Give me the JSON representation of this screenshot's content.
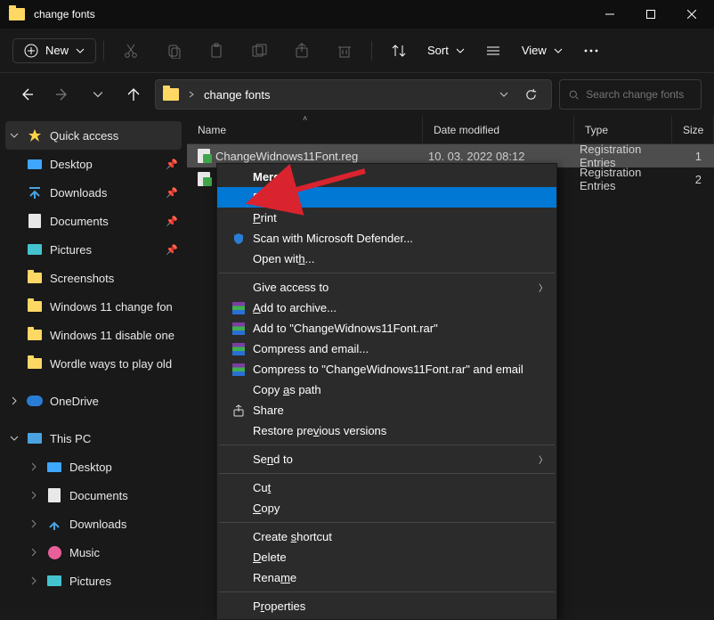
{
  "window": {
    "title": "change fonts"
  },
  "toolbar": {
    "new": "New",
    "sort": "Sort",
    "view": "View"
  },
  "address": {
    "crumb": "change fonts",
    "search_placeholder": "Search change fonts"
  },
  "columns": {
    "name": "Name",
    "date": "Date modified",
    "type": "Type",
    "size": "Size"
  },
  "files": [
    {
      "name": "ChangeWidnows11Font.reg",
      "date": "10. 03. 2022 08:12",
      "type": "Registration Entries",
      "size": "1"
    },
    {
      "name": "",
      "date": "",
      "type": "Registration Entries",
      "size": "2"
    }
  ],
  "sidebar": {
    "quick": "Quick access",
    "items": [
      "Desktop",
      "Downloads",
      "Documents",
      "Pictures",
      "Screenshots",
      "Windows 11 change fon",
      "Windows 11 disable one",
      "Wordle ways to play old"
    ],
    "onedrive": "OneDrive",
    "thispc": "This PC",
    "pcitems": [
      "Desktop",
      "Documents",
      "Downloads",
      "Music",
      "Pictures"
    ]
  },
  "context": {
    "merge": "Merge",
    "edit": "Edit",
    "print": "Print",
    "scan": "Scan with Microsoft Defender...",
    "openwith": "Open with...",
    "giveaccess": "Give access to",
    "addarchive": "Add to archive...",
    "addto": "Add to \"ChangeWidnows11Font.rar\"",
    "compressemail": "Compress and email...",
    "compressto": "Compress to \"ChangeWidnows11Font.rar\" and email",
    "copypath": "Copy as path",
    "share": "Share",
    "restore": "Restore previous versions",
    "sendto": "Send to",
    "cut": "Cut",
    "copy": "Copy",
    "shortcut": "Create shortcut",
    "delete": "Delete",
    "rename": "Rename",
    "properties": "Properties"
  }
}
